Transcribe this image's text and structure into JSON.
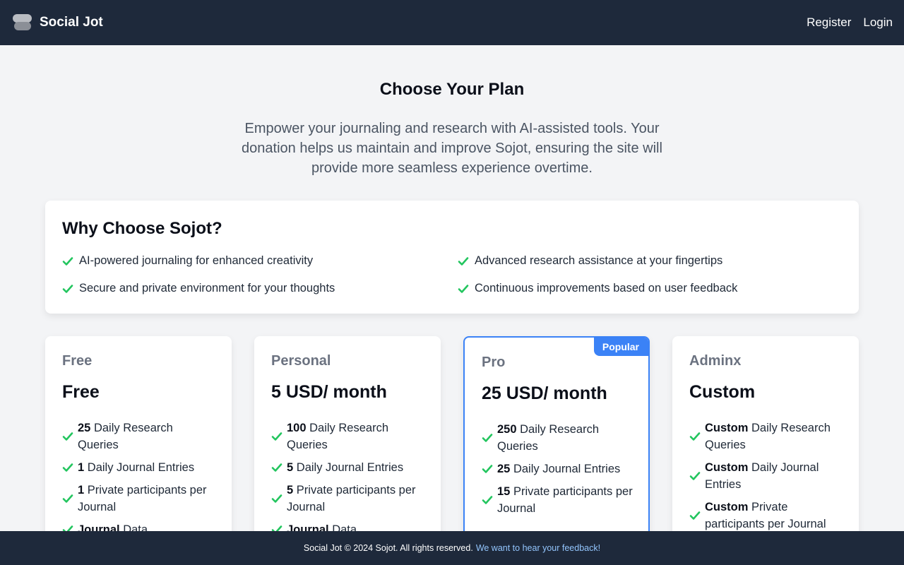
{
  "header": {
    "brand": "Social Jot",
    "nav": {
      "register": "Register",
      "login": "Login"
    }
  },
  "main": {
    "title": "Choose Your Plan",
    "intro": "Empower your journaling and research with AI-assisted tools. Your donation helps us maintain and improve Sojot, ensuring the site will provide more seamless experience overtime."
  },
  "why": {
    "title": "Why Choose Sojot?",
    "items": [
      "AI-powered journaling for enhanced creativity",
      "Advanced research assistance at your fingertips",
      "Secure and private environment for your thoughts",
      "Continuous improvements based on user feedback"
    ]
  },
  "plans": [
    {
      "tier": "Free",
      "price": "Free",
      "features": [
        {
          "value": "25",
          "label": "Daily Research Queries"
        },
        {
          "value": "1",
          "label": "Daily Journal Entries"
        },
        {
          "value": "1",
          "label": "Private participants per Journal"
        },
        {
          "value": "Journal",
          "label": "Data"
        }
      ]
    },
    {
      "tier": "Personal",
      "price": "5 USD/ month",
      "features": [
        {
          "value": "100",
          "label": "Daily Research Queries"
        },
        {
          "value": "5",
          "label": "Daily Journal Entries"
        },
        {
          "value": "5",
          "label": "Private participants per Journal"
        },
        {
          "value": "Journal",
          "label": "Data"
        }
      ]
    },
    {
      "tier": "Pro",
      "badge": "Popular",
      "price": "25 USD/ month",
      "features": [
        {
          "value": "250",
          "label": "Daily Research Queries"
        },
        {
          "value": "25",
          "label": "Daily Journal Entries"
        },
        {
          "value": "15",
          "label": "Private participants per Journal"
        }
      ]
    },
    {
      "tier": "Adminx",
      "price": "Custom",
      "features": [
        {
          "value": "Custom",
          "label": "Daily Research Queries"
        },
        {
          "value": "Custom",
          "label": "Daily Journal Entries"
        },
        {
          "value": "Custom",
          "label": "Private participants per Journal"
        }
      ]
    }
  ],
  "footer": {
    "copyright": "Social Jot © 2024 Sojot. All rights reserved.",
    "feedback_link": "We want to hear your feedback!"
  },
  "colors": {
    "navbar": "#1e293b",
    "accent": "#3b82f6",
    "check": "#22c55e",
    "background": "#f3f4f6"
  }
}
